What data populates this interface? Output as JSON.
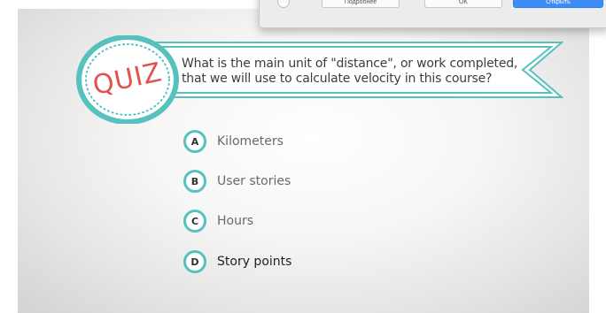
{
  "dialog": {
    "buttons": [
      {
        "label": "Подробнее",
        "style": "gray"
      },
      {
        "label": "OK",
        "style": "gray"
      },
      {
        "label": "Открыть",
        "style": "blue"
      }
    ]
  },
  "quiz": {
    "badge": "QUIZ",
    "question_lines": [
      "What is the main unit of \"distance\", or work completed,",
      "that we will use to calculate velocity in this course?"
    ],
    "answers": [
      {
        "letter": "A",
        "text": "Kilometers"
      },
      {
        "letter": "B",
        "text": "User stories"
      },
      {
        "letter": "C",
        "text": "Hours"
      },
      {
        "letter": "D",
        "text": "Story points"
      }
    ]
  },
  "colors": {
    "teal": "#57c2bd",
    "quiz_red": "#e3524d",
    "dialog_blue": "#3c8ef6"
  }
}
